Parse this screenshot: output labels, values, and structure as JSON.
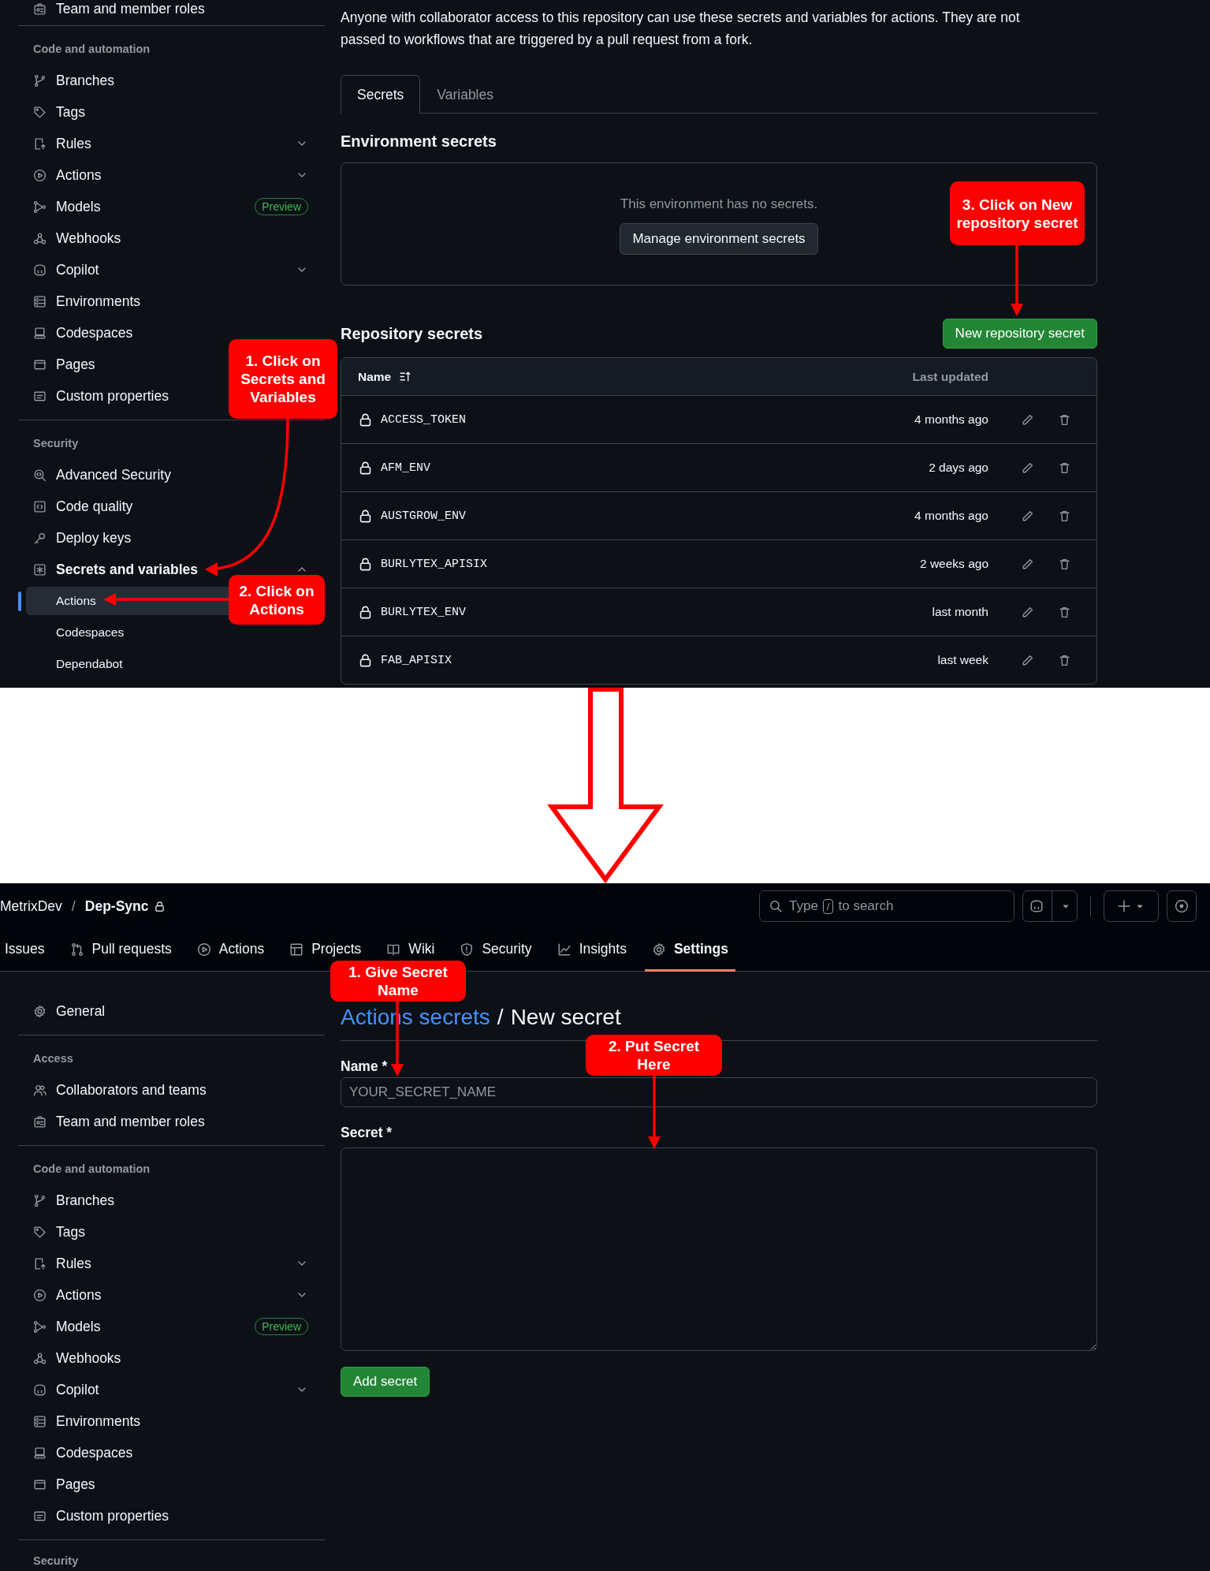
{
  "top_panel": {
    "sidebar": {
      "sections": [
        {
          "items": [
            {
              "label": "Team and member roles"
            }
          ]
        },
        {
          "heading": "Code and automation",
          "items": [
            {
              "label": "Branches"
            },
            {
              "label": "Tags"
            },
            {
              "label": "Rules",
              "expanded": false
            },
            {
              "label": "Actions",
              "expanded": false
            },
            {
              "label": "Models",
              "badge": "Preview"
            },
            {
              "label": "Webhooks"
            },
            {
              "label": "Copilot",
              "expanded": false
            },
            {
              "label": "Environments"
            },
            {
              "label": "Codespaces"
            },
            {
              "label": "Pages"
            },
            {
              "label": "Custom properties"
            }
          ]
        },
        {
          "heading": "Security",
          "items": [
            {
              "label": "Advanced Security"
            },
            {
              "label": "Code quality"
            },
            {
              "label": "Deploy keys"
            },
            {
              "label": "Secrets and variables",
              "expanded": true,
              "children": [
                {
                  "label": "Actions",
                  "selected": true
                },
                {
                  "label": "Codespaces",
                  "selected": false
                },
                {
                  "label": "Dependabot",
                  "selected": false
                }
              ]
            }
          ]
        }
      ]
    },
    "description": "Anyone with collaborator access to this repository can use these secrets and variables for actions. They are not passed to workflows that are triggered by a pull request from a fork.",
    "tabs": [
      {
        "label": "Secrets",
        "selected": true
      },
      {
        "label": "Variables",
        "selected": false
      }
    ],
    "environment_secrets": {
      "title": "Environment secrets",
      "empty_text": "This environment has no secrets.",
      "button": "Manage environment secrets"
    },
    "repository_secrets": {
      "title": "Repository secrets",
      "button": "New repository secret",
      "columns": [
        "Name",
        "Last updated"
      ],
      "rows": [
        {
          "name": "ACCESS_TOKEN",
          "updated": "4 months ago"
        },
        {
          "name": "AFM_ENV",
          "updated": "2 days ago"
        },
        {
          "name": "AUSTGROW_ENV",
          "updated": "4 months ago"
        },
        {
          "name": "BURLYTEX_APISIX",
          "updated": "2 weeks ago"
        },
        {
          "name": "BURLYTEX_ENV",
          "updated": "last month"
        },
        {
          "name": "FAB_APISIX",
          "updated": "last week"
        }
      ]
    },
    "annotations": [
      {
        "text": "1. Click on\nSecrets and\nVariables"
      },
      {
        "text": "2. Click on\nActions"
      },
      {
        "text": "3. Click on New\nrepository secret"
      }
    ]
  },
  "bottom_panel": {
    "header": {
      "owner": "MetrixDev",
      "separator": "/",
      "repo": "Dep-Sync",
      "search": {
        "prefix": "Type",
        "key": "/",
        "suffix": "to search"
      }
    },
    "nav": [
      {
        "label": "Issues",
        "selected": false
      },
      {
        "label": "Pull requests",
        "selected": false
      },
      {
        "label": "Actions",
        "selected": false
      },
      {
        "label": "Projects",
        "selected": false
      },
      {
        "label": "Wiki",
        "selected": false
      },
      {
        "label": "Security",
        "selected": false
      },
      {
        "label": "Insights",
        "selected": false
      },
      {
        "label": "Settings",
        "selected": true
      }
    ],
    "sidebar": {
      "sections": [
        {
          "items": [
            {
              "label": "General"
            }
          ]
        },
        {
          "heading": "Access",
          "items": [
            {
              "label": "Collaborators and teams"
            },
            {
              "label": "Team and member roles"
            }
          ]
        },
        {
          "heading": "Code and automation",
          "items": [
            {
              "label": "Branches"
            },
            {
              "label": "Tags"
            },
            {
              "label": "Rules",
              "expanded": false
            },
            {
              "label": "Actions",
              "expanded": false
            },
            {
              "label": "Models",
              "badge": "Preview"
            },
            {
              "label": "Webhooks"
            },
            {
              "label": "Copilot",
              "expanded": false
            },
            {
              "label": "Environments"
            },
            {
              "label": "Codespaces"
            },
            {
              "label": "Pages"
            },
            {
              "label": "Custom properties"
            }
          ]
        },
        {
          "heading": "Security"
        }
      ]
    },
    "breadcrumb": {
      "link": "Actions secrets",
      "separator": "/",
      "current": "New secret"
    },
    "form": {
      "name_label": "Name *",
      "name_placeholder": "YOUR_SECRET_NAME",
      "secret_label": "Secret *",
      "submit": "Add secret"
    },
    "annotations": [
      {
        "text": "1. Give Secret\nName"
      },
      {
        "text": "2. Put Secret\nHere"
      }
    ]
  }
}
